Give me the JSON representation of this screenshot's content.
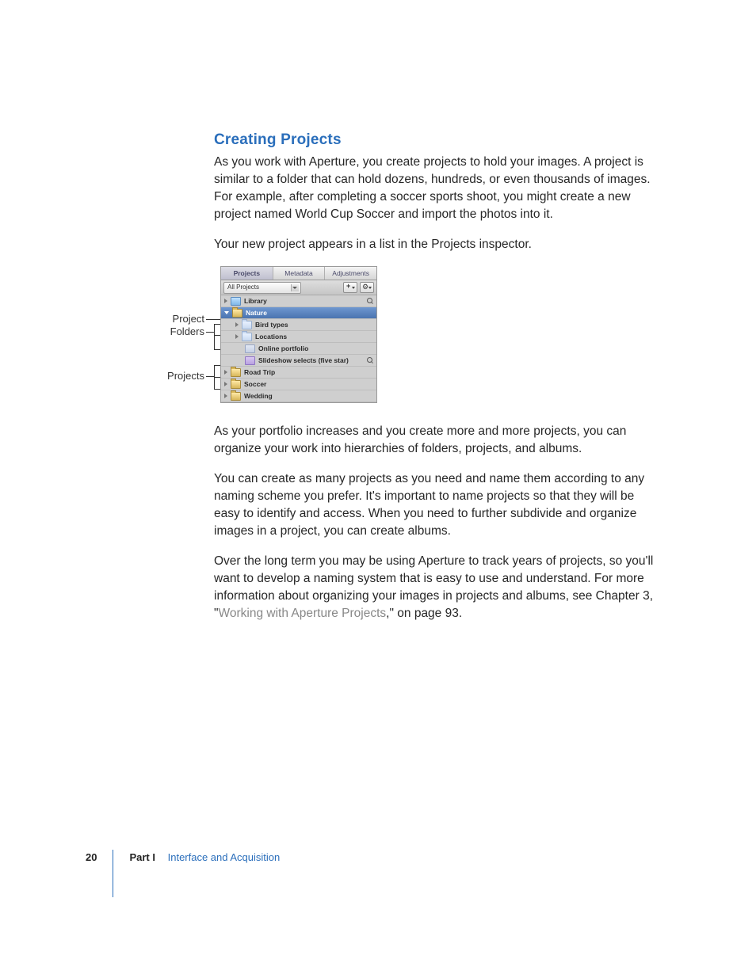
{
  "heading": "Creating Projects",
  "para1": "As you work with Aperture, you create projects to hold your images. A project is similar to a folder that can hold dozens, hundreds, or even thousands of images. For example, after completing a soccer sports shoot, you might create a new project named World Cup Soccer and import the photos into it.",
  "para2": "Your new project appears in a list in the Projects inspector.",
  "para3": "As your portfolio increases and you create more and more projects, you can organize your work into hierarchies of folders, projects, and albums.",
  "para4": "You can create as many projects as you need and name them according to any naming scheme you prefer. It's important to name projects so that they will be easy to identify and access. When you need to further subdivide and organize images in a project, you can create albums.",
  "para5a": "Over the long term you may be using Aperture to track years of projects, so you'll want to develop a naming system that is easy to use and understand. For more information about organizing your images in projects and albums, see Chapter 3, \"",
  "para5link": "Working with Aperture Projects",
  "para5b": ",\" on page 93.",
  "callouts": {
    "project": "Project",
    "folders": "Folders",
    "projects": "Projects"
  },
  "inspector": {
    "tabs": [
      "Projects",
      "Metadata",
      "Adjustments"
    ],
    "dropdown": "All Projects",
    "rows": {
      "library": "Library",
      "nature": "Nature",
      "birdtypes": "Bird types",
      "locations": "Locations",
      "online": "Online portfolio",
      "slideshow": "Slideshow selects (five star)",
      "roadtrip": "Road Trip",
      "soccer": "Soccer",
      "wedding": "Wedding"
    }
  },
  "footer": {
    "page": "20",
    "part": "Part I",
    "title": "Interface and Acquisition"
  }
}
